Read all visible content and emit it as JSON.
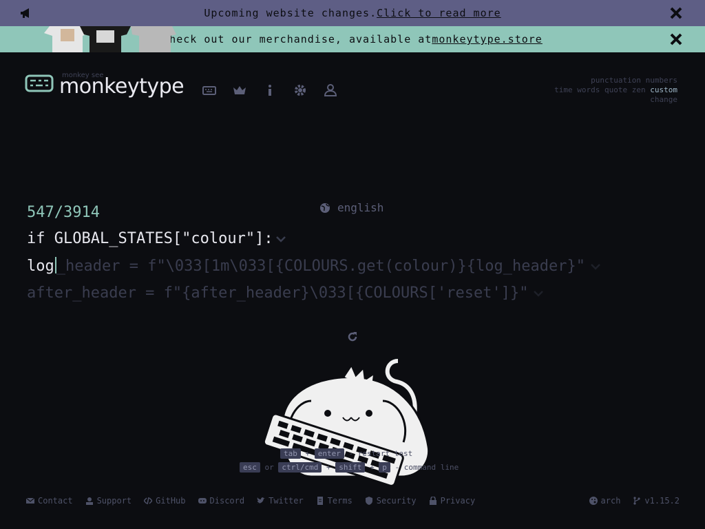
{
  "banners": {
    "top": {
      "text": "Upcoming website changes. ",
      "link": "Click to read more"
    },
    "merch": {
      "text": "Check out our merchandise, available at ",
      "link": "monkeytype.store"
    }
  },
  "header": {
    "subtitle": "monkey see",
    "title": "monkeytype",
    "nav_icons": [
      "keyboard-icon",
      "crown-icon",
      "info-icon",
      "gear-icon",
      "user-icon"
    ]
  },
  "config": {
    "row1": [
      "punctuation",
      "numbers"
    ],
    "row2": [
      "time",
      "words",
      "quote",
      "zen"
    ],
    "row2_active": "custom",
    "row3": "change"
  },
  "test": {
    "language": "english",
    "counter": "547/3914",
    "line1": "if GLOBAL_STATES[\"colour\"]:",
    "line2_typed": "log",
    "line2_rest": "_header = f\"\\033[1m\\033[{COLOURS.get(colour)}{log_header}\"",
    "line3": "after_header = f\"{after_header}\\033[{COLOURS['reset']}\""
  },
  "hints": {
    "row1": {
      "key1": "tab",
      "plus": "+",
      "key2": "enter",
      "dash": "-",
      "action": "restart test"
    },
    "row2": {
      "key1": "esc",
      "or": "or",
      "key2": "ctrl/cmd",
      "plus1": "+",
      "key3": "shift",
      "plus2": "+",
      "key4": "p",
      "dash": "-",
      "action": "command line"
    }
  },
  "footer": {
    "links": [
      "Contact",
      "Support",
      "GitHub",
      "Discord",
      "Twitter",
      "Terms",
      "Security",
      "Privacy"
    ],
    "theme": "arch",
    "version": "v1.15.2"
  },
  "colors": {
    "bg": "#0c0d11",
    "main": "#8fc6b9",
    "text": "#e8e8ef",
    "sub": "#3a3d4f",
    "banner": "#5e5e85"
  }
}
